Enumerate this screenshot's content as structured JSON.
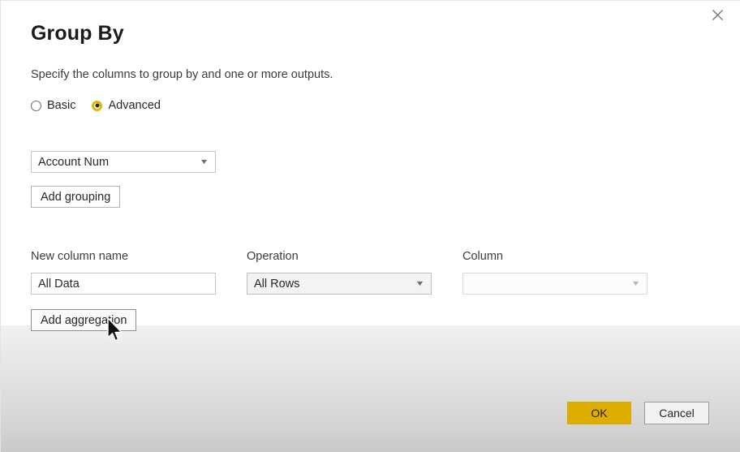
{
  "dialog": {
    "title": "Group By",
    "subtitle": "Specify the columns to group by and one or more outputs.",
    "close_icon": "close-icon"
  },
  "mode": {
    "options": [
      {
        "label": "Basic",
        "selected": false
      },
      {
        "label": "Advanced",
        "selected": true
      }
    ]
  },
  "grouping": {
    "column_value": "Account Num",
    "dropdown_icon": "chevron-down-icon",
    "add_button_label": "Add grouping"
  },
  "aggregation": {
    "headers": {
      "new_column_name": "New column name",
      "operation": "Operation",
      "column": "Column"
    },
    "rows": [
      {
        "new_column_name_value": "All Data",
        "new_column_name_placeholder": "",
        "operation_value": "All Rows",
        "column_value": "",
        "column_placeholder": "",
        "column_disabled": true
      }
    ],
    "add_button_label": "Add aggregation"
  },
  "footer": {
    "ok_label": "OK",
    "cancel_label": "Cancel"
  },
  "colors": {
    "accent_gold": "#ddad00",
    "radio_gold": "#e3b505",
    "text_primary": "#262626",
    "border": "#c4c4c4"
  }
}
